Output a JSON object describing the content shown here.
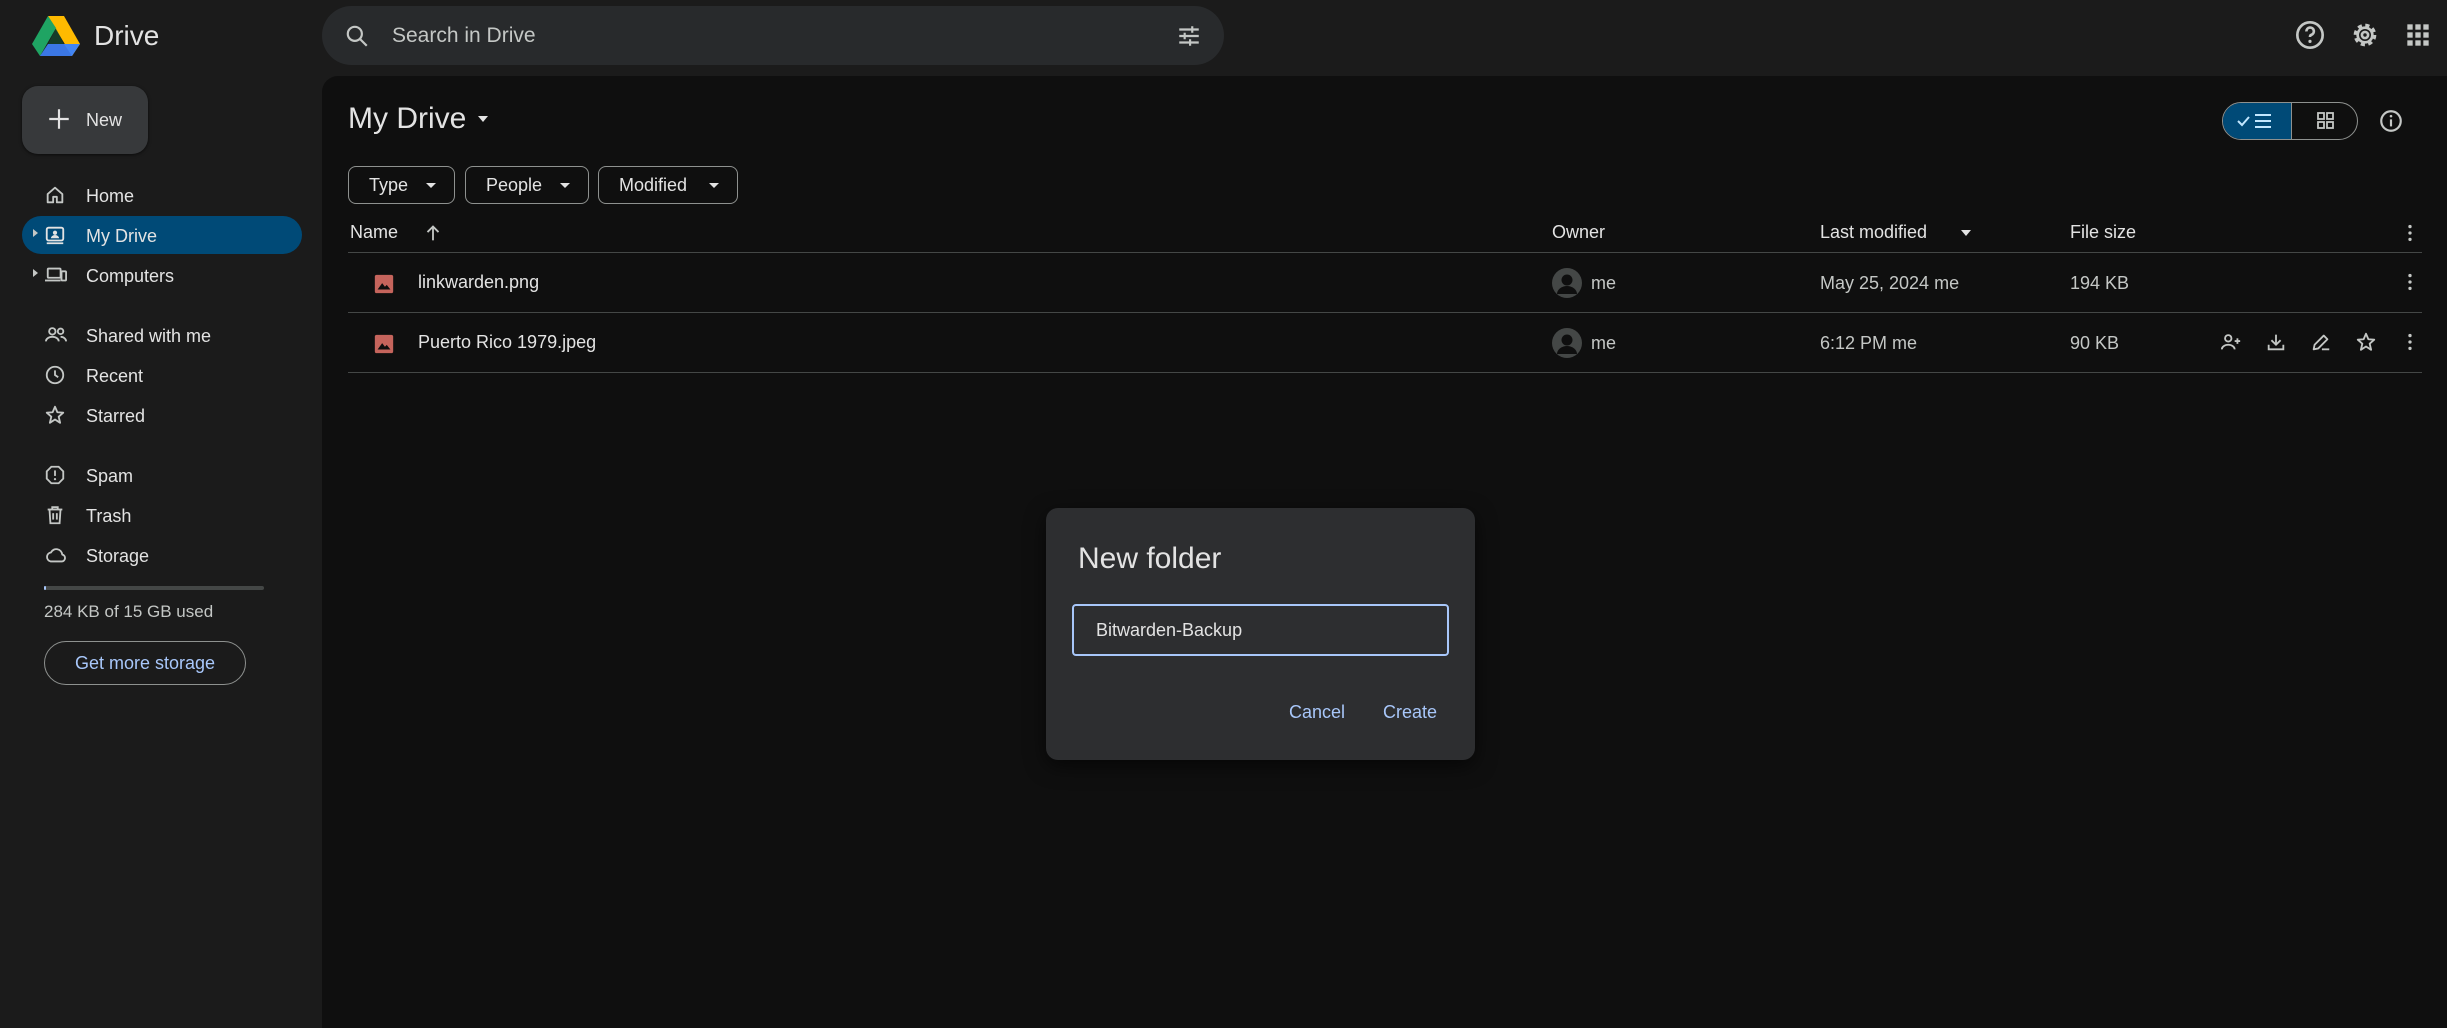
{
  "app": {
    "name": "Drive"
  },
  "search": {
    "placeholder": "Search in Drive"
  },
  "sidebar": {
    "new_label": "New",
    "items": [
      {
        "label": "Home"
      },
      {
        "label": "My Drive"
      },
      {
        "label": "Computers"
      },
      {
        "label": "Shared with me"
      },
      {
        "label": "Recent"
      },
      {
        "label": "Starred"
      },
      {
        "label": "Spam"
      },
      {
        "label": "Trash"
      },
      {
        "label": "Storage"
      }
    ],
    "active_item": "My Drive",
    "storage_used_text": "284 KB of 15 GB used",
    "storage_used_fraction": 2e-05,
    "get_more_storage": "Get more storage"
  },
  "main": {
    "title": "My Drive",
    "filters": [
      {
        "label": "Type"
      },
      {
        "label": "People"
      },
      {
        "label": "Modified"
      }
    ],
    "view_mode": "list",
    "columns": {
      "name": "Name",
      "owner": "Owner",
      "last_modified": "Last modified",
      "file_size": "File size"
    },
    "sort": {
      "column": "Name",
      "direction": "ascending"
    },
    "files": [
      {
        "name": "linkwarden.png",
        "owner": "me",
        "modified": "May 25, 2024 me",
        "size": "194 KB"
      },
      {
        "name": "Puerto Rico 1979.jpeg",
        "owner": "me",
        "modified": "6:12 PM me",
        "size": "90 KB"
      }
    ]
  },
  "dialog": {
    "title": "New folder",
    "input_value": "Bitwarden-Backup",
    "cancel_label": "Cancel",
    "create_label": "Create"
  },
  "colors": {
    "background": "#1b1b1b",
    "main_panel": "#0f0f0f",
    "accent": "#a8c7fa",
    "active_nav": "#004a77",
    "image_file_icon": "#c5645c",
    "dialog": "#2d2e30"
  }
}
